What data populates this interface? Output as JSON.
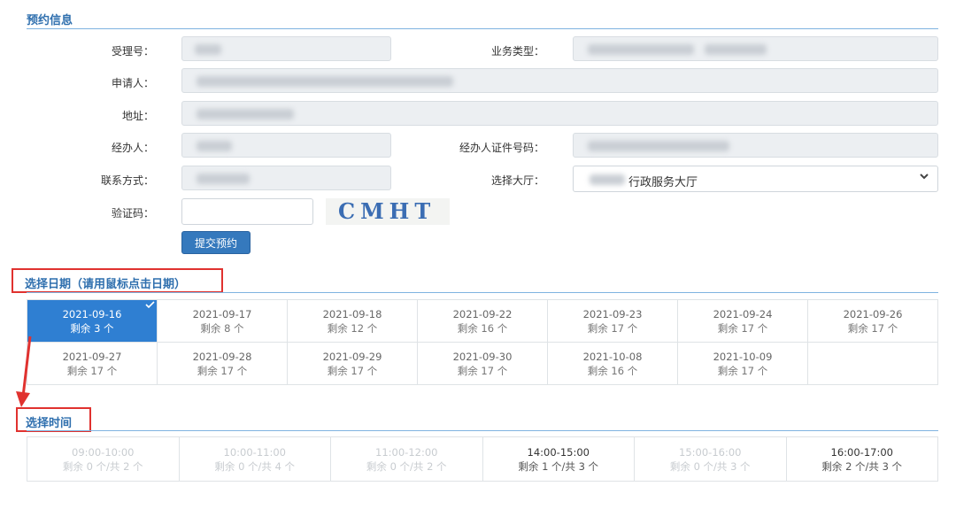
{
  "sections": {
    "info_title": "预约信息",
    "date_title": "选择日期（请用鼠标点击日期）",
    "time_title": "选择时间"
  },
  "form": {
    "accept_no_label": "受理号：",
    "business_type_label": "业务类型：",
    "applicant_label": "申请人：",
    "address_label": "地址：",
    "handler_label": "经办人：",
    "handler_id_label": "经办人证件号码：",
    "contact_label": "联系方式：",
    "hall_label": "选择大厅：",
    "hall_value": "行政服务大厅",
    "captcha_label": "验证码：",
    "captcha_value": "",
    "captcha_image_text": "CMHT",
    "submit_label": "提交预约"
  },
  "dates": [
    {
      "date": "2021-09-16",
      "remain": "剩余 3 个",
      "selected": true
    },
    {
      "date": "2021-09-17",
      "remain": "剩余 8 个"
    },
    {
      "date": "2021-09-18",
      "remain": "剩余 12 个"
    },
    {
      "date": "2021-09-22",
      "remain": "剩余 16 个"
    },
    {
      "date": "2021-09-23",
      "remain": "剩余 17 个"
    },
    {
      "date": "2021-09-24",
      "remain": "剩余 17 个"
    },
    {
      "date": "2021-09-26",
      "remain": "剩余 17 个"
    },
    {
      "date": "2021-09-27",
      "remain": "剩余 17 个"
    },
    {
      "date": "2021-09-28",
      "remain": "剩余 17 个"
    },
    {
      "date": "2021-09-29",
      "remain": "剩余 17 个"
    },
    {
      "date": "2021-09-30",
      "remain": "剩余 17 个"
    },
    {
      "date": "2021-10-08",
      "remain": "剩余 16 个"
    },
    {
      "date": "2021-10-09",
      "remain": "剩余 17 个"
    }
  ],
  "times": [
    {
      "slot": "09:00-10:00",
      "remain": "剩余 0 个/共 2 个",
      "available": false
    },
    {
      "slot": "10:00-11:00",
      "remain": "剩余 0 个/共 4 个",
      "available": false
    },
    {
      "slot": "11:00-12:00",
      "remain": "剩余 0 个/共 2 个",
      "available": false
    },
    {
      "slot": "14:00-15:00",
      "remain": "剩余 1 个/共 3 个",
      "available": true
    },
    {
      "slot": "15:00-16:00",
      "remain": "剩余 0 个/共 3 个",
      "available": false
    },
    {
      "slot": "16:00-17:00",
      "remain": "剩余 2 个/共 3 个",
      "available": true
    }
  ],
  "colors": {
    "accent": "#2f7fd2",
    "highlight_box": "#e0322f",
    "title": "#2f6fae"
  }
}
